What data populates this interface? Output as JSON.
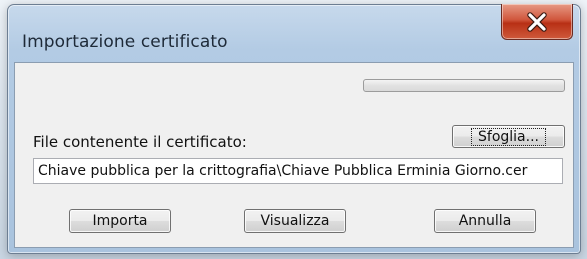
{
  "window": {
    "title": "Importazione certificato"
  },
  "titlebar": {
    "close_icon": "close-icon"
  },
  "progress": {
    "value_percent": 0
  },
  "form": {
    "file_label": "File contenente il certificato:",
    "browse_label": "Sfoglia...",
    "path_value": "Chiave pubblica per la crittografia\\Chiave Pubblica Erminia Giorno.cer"
  },
  "actions": {
    "import_label": "Importa",
    "view_label": "Visualizza",
    "cancel_label": "Annulla"
  },
  "colors": {
    "close_button": "#c7472b",
    "window_frame": "#b3cbe4",
    "client_bg": "#f0f0f0"
  }
}
